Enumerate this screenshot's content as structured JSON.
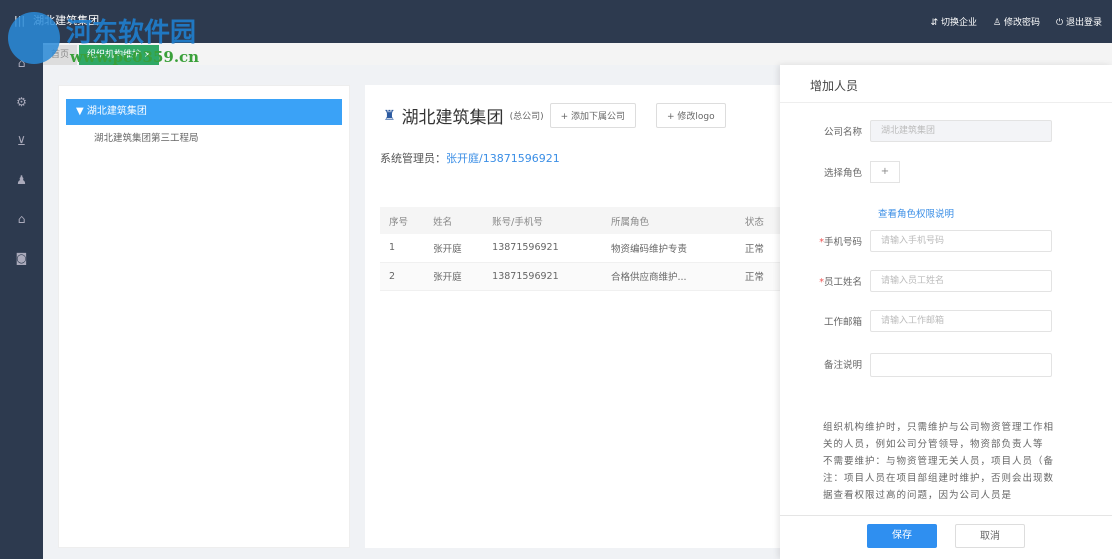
{
  "header": {
    "app_title": "湖北建筑集团",
    "actions": [
      {
        "icon": "switch-icon",
        "glyph": "⇵",
        "label": "切换企业"
      },
      {
        "icon": "user-icon",
        "glyph": "♙",
        "label": "修改密码"
      },
      {
        "icon": "power-icon",
        "glyph": "⏻",
        "label": "退出登录"
      }
    ]
  },
  "watermark": {
    "title": "河东软件园",
    "url": "www.pc0359.cn"
  },
  "sidebar": {
    "icons": [
      {
        "name": "home-icon",
        "glyph": "⌂"
      },
      {
        "name": "gear-icon",
        "glyph": "⚙"
      },
      {
        "name": "cart-icon",
        "glyph": "⊻"
      },
      {
        "name": "users-icon",
        "glyph": "♟"
      },
      {
        "name": "house-icon",
        "glyph": "⌂"
      },
      {
        "name": "chart-icon",
        "glyph": "◙"
      }
    ]
  },
  "tabs": {
    "home": "首页",
    "active": "组织机构维护",
    "close": "×"
  },
  "tree": {
    "root": "湖北建筑集团",
    "children": [
      "湖北建筑集团第三工程局"
    ]
  },
  "main": {
    "company": "湖北建筑集团",
    "company_type": "(总公司)",
    "add_sub_btn": "+ 添加下属公司",
    "edit_logo_btn": "+ 修改logo",
    "admin_label": "系统管理员：",
    "admin_value": "张开庭/13871596921",
    "table": {
      "headers": [
        "序号",
        "姓名",
        "账号/手机号",
        "所属角色",
        "状态"
      ],
      "rows": [
        [
          "1",
          "张开庭",
          "13871596921",
          "物资编码维护专责",
          "正常"
        ],
        [
          "2",
          "张开庭",
          "13871596921",
          "合格供应商维护...",
          "正常"
        ]
      ]
    }
  },
  "drawer": {
    "title": "增加人员",
    "company_label": "公司名称",
    "company_value": "湖北建筑集团",
    "role_label": "选择角色",
    "role_add": "+",
    "role_link": "查看角色权限说明",
    "phone_label": "手机号码",
    "phone_placeholder": "请输入手机号码",
    "name_label": "员工姓名",
    "name_placeholder": "请输入员工姓名",
    "email_label": "工作邮箱",
    "email_placeholder": "请输入工作邮箱",
    "remark_label": "备注说明",
    "required_mark": "*",
    "note": "组织机构维护时，只需维护与公司物资管理工作相关的人员，例如公司分管领导，物资部负责人等\n不需要维护：与物资管理无关人员，项目人员（备注：项目人员在项目部组建时维护，否则会出现数据查看权限过高的问题，因为公司人员是",
    "save": "保存",
    "cancel": "取消"
  }
}
